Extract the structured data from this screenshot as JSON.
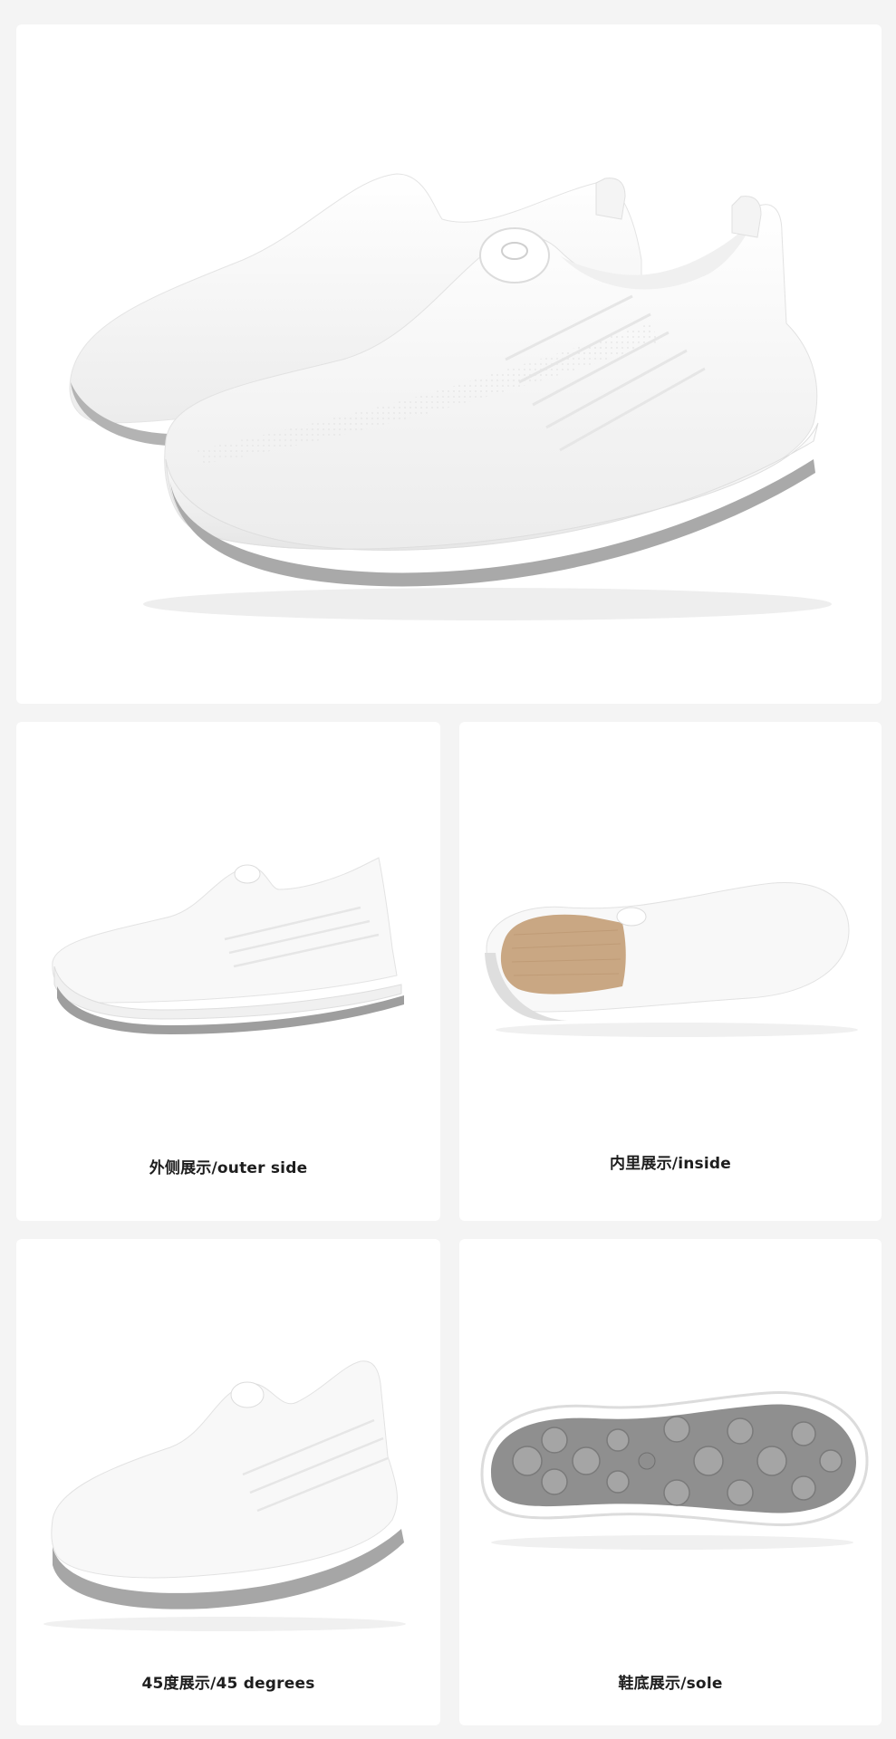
{
  "page": {
    "background": "#f4f4f4",
    "card_background": "#ffffff"
  },
  "hero": {
    "image": "white-knit-slip-on-sneakers-pair"
  },
  "views": [
    {
      "caption": "外侧展示/outer side",
      "image": "sneaker-outer-side-view"
    },
    {
      "caption": "内里展示/inside",
      "image": "sneaker-inside-top-view"
    },
    {
      "caption": "45度展示/45 degrees",
      "image": "sneaker-45-degree-view"
    },
    {
      "caption": "鞋底展示/sole",
      "image": "sneaker-sole-view"
    }
  ],
  "colors": {
    "upper": "#f7f7f7",
    "sole_trim": "#a9a9a9",
    "outsole": "#8f8f8f",
    "insole": "#c9a783",
    "caption_text": "#1d1d1d"
  }
}
